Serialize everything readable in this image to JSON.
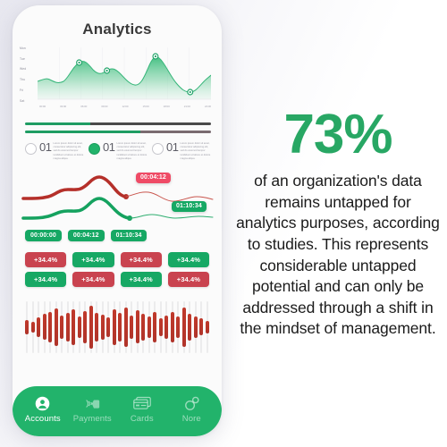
{
  "phone": {
    "title": "Analytics",
    "area_chart": {
      "y_labels": [
        "Mon",
        "Tue",
        "Wed",
        "Thu",
        "Fri",
        "Sat"
      ],
      "x_labels": [
        "00:00",
        "03:00",
        "06:00",
        "09:00",
        "12:00",
        "15:00",
        "18:00",
        "21:00",
        "24:00"
      ]
    },
    "progress_bars": [
      {
        "fill_percent": 35,
        "rest_color": "#4a4a4a"
      },
      {
        "fill_percent": 62,
        "rest_color": "#7a6b70"
      }
    ],
    "items": [
      {
        "number": "01",
        "selected": false,
        "text": "Lorem ipsum dolor sit amet, consectetur adipiscing elit, sed do eiusmod tempor incididunt ut labore et dolore magna aliqua."
      },
      {
        "number": "01",
        "selected": true,
        "text": "Lorem ipsum dolor sit amet, consectetur adipiscing elit, sed do eiusmod tempor incididunt ut labore et dolore magna aliqua."
      },
      {
        "number": "01",
        "selected": false,
        "text": "Lorem ipsum dolor sit amet, consectetur adipiscing elit, sed do eiusmod tempor incididunt ut labore et dolore magna aliqua."
      }
    ],
    "timeline": {
      "red_badge": "00:04:12",
      "green_badge": "01:10:34",
      "chips": [
        "00:00:00",
        "00:04:12",
        "01:10:34"
      ]
    },
    "percent_badges": [
      {
        "label": "+34.4%",
        "color": "red"
      },
      {
        "label": "+34.4%",
        "color": "green"
      },
      {
        "label": "+34.4%",
        "color": "red"
      },
      {
        "label": "+34.4%",
        "color": "green"
      },
      {
        "label": "+34.4%",
        "color": "green"
      },
      {
        "label": "+34.4%",
        "color": "red"
      },
      {
        "label": "+34.4%",
        "color": "green"
      },
      {
        "label": "+34.4%",
        "color": "red"
      }
    ],
    "nav": [
      {
        "label": "Accounts",
        "icon": "person-icon",
        "active": true
      },
      {
        "label": "Payments",
        "icon": "contactless-payment-icon",
        "active": false
      },
      {
        "label": "Cards",
        "icon": "credit-card-icon",
        "active": false
      },
      {
        "label": "Nore",
        "icon": "two-circles-icon",
        "active": false
      }
    ]
  },
  "stat": {
    "number": "73%",
    "body": "of an organization's data remains untapped for analytics purposes, according to studies. This represents considerable untapped potential and can only be addressed through a shift in the mindset of management."
  },
  "colors": {
    "brand_green": "#22b36b",
    "accent_green": "#16a864",
    "accent_red": "#c9434f",
    "badge_pink": "#ef4b66",
    "title_gray": "#3a3a3a"
  },
  "chart_data": [
    {
      "type": "area",
      "title": "Analytics",
      "xlabel": "",
      "ylabel": "",
      "x": [
        0,
        1,
        2,
        3,
        4,
        5,
        6,
        7,
        8,
        9,
        10,
        11,
        12,
        13,
        14,
        15,
        16
      ],
      "values": [
        42,
        38,
        34,
        48,
        72,
        55,
        47,
        62,
        52,
        34,
        26,
        82,
        58,
        36,
        14,
        30,
        66
      ],
      "markers": [
        {
          "x": 4,
          "y": 72
        },
        {
          "x": 7,
          "y": 62
        },
        {
          "x": 11,
          "y": 82
        },
        {
          "x": 14,
          "y": 14
        }
      ],
      "categories": [
        "Mon",
        "Tue",
        "Wed",
        "Thu",
        "Fri",
        "Sat"
      ],
      "ylim": [
        0,
        100
      ],
      "grid": true,
      "legend": "none"
    },
    {
      "type": "line",
      "title": "",
      "series": [
        {
          "name": "red-timeline",
          "values": [
            28,
            28,
            26,
            20,
            20,
            8,
            2,
            14,
            22,
            20,
            26,
            22,
            30,
            26
          ]
        },
        {
          "name": "green-timeline",
          "values": [
            50,
            50,
            48,
            42,
            42,
            30,
            26,
            34,
            38,
            44,
            52,
            48,
            50,
            48
          ]
        }
      ],
      "annotations": [
        "00:04:12",
        "01:10:34"
      ],
      "legend": "none"
    },
    {
      "type": "bar",
      "title": "",
      "categories": [
        "1",
        "2",
        "3",
        "4",
        "5",
        "6",
        "7",
        "8",
        "9",
        "10",
        "11",
        "12",
        "13",
        "14",
        "15",
        "16",
        "17",
        "18",
        "19",
        "20",
        "21",
        "22",
        "23",
        "24",
        "25",
        "26",
        "27",
        "28",
        "29",
        "30",
        "31",
        "32"
      ],
      "values": [
        30,
        22,
        40,
        52,
        62,
        74,
        46,
        56,
        70,
        42,
        64,
        86,
        58,
        50,
        38,
        72,
        56,
        78,
        48,
        66,
        54,
        42,
        60,
        36,
        48,
        62,
        44,
        80,
        54,
        44,
        34,
        26
      ],
      "ylim": [
        0,
        100
      ],
      "grid": false,
      "legend": "none"
    }
  ]
}
